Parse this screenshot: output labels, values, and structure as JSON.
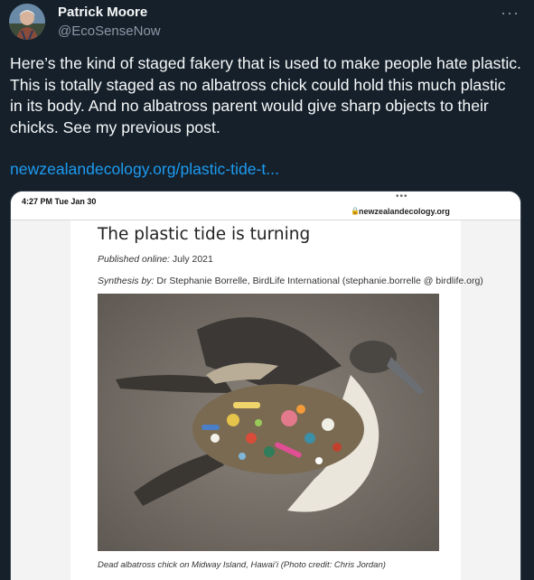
{
  "author": {
    "name": "Patrick Moore",
    "handle": "@EcoSenseNow"
  },
  "menu_icon": "more-dots-icon",
  "tweet": {
    "text": "Here’s the kind of staged fakery that is used to make people hate plastic.\nThis is totally staged as no albatross chick could hold this much plastic\nin its body. And no albatross parent would give sharp objects to their\nchicks. See my previous post.",
    "link": "newzealandecology.org/plastic-tide-t..."
  },
  "screenshot": {
    "time": "4:27 PM   Tue Jan 30",
    "dots": "•••",
    "url": "newzealandecology.org",
    "article": {
      "title": "The plastic tide is turning",
      "published_label": "Published online:",
      "published_value": "July 2021",
      "synthesis_label": "Synthesis by:",
      "synthesis_value": "Dr Stephanie Borrelle, BirdLife International (stephanie.borrelle @ birdlife.org)",
      "caption": "Dead albatross chick on Midway Island, Hawai’i (Photo credit: Chris Jordan)"
    }
  }
}
